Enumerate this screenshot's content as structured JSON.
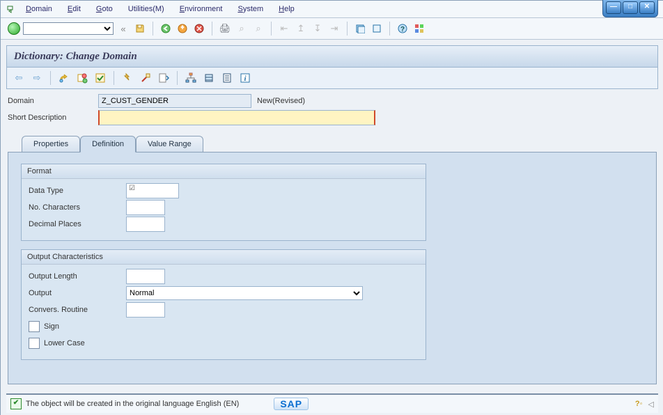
{
  "menu": {
    "domain": "Domain",
    "edit": "Edit",
    "goto": "Goto",
    "utilities": "Utilities(M)",
    "environment": "Environment",
    "system": "System",
    "help": "Help"
  },
  "title": "Dictionary: Change Domain",
  "header": {
    "domain_label": "Domain",
    "domain_value": "Z_CUST_GENDER",
    "domain_status": "New(Revised)",
    "shortdesc_label": "Short Description",
    "shortdesc_value": ""
  },
  "tabs": {
    "properties": "Properties",
    "definition": "Definition",
    "value_range": "Value Range"
  },
  "format_group": {
    "title": "Format",
    "data_type": "Data Type",
    "data_type_value": "",
    "no_characters": "No. Characters",
    "no_characters_value": "",
    "decimal_places": "Decimal Places",
    "decimal_places_value": ""
  },
  "output_group": {
    "title": "Output Characteristics",
    "output_length": "Output Length",
    "output_length_value": "",
    "output": "Output",
    "output_value": "Normal",
    "convers_routine": "Convers. Routine",
    "convers_routine_value": "",
    "sign": "Sign",
    "lower_case": "Lower Case"
  },
  "statusbar": {
    "message": "The object will be created in the original language English (EN)",
    "logo": "SAP"
  }
}
